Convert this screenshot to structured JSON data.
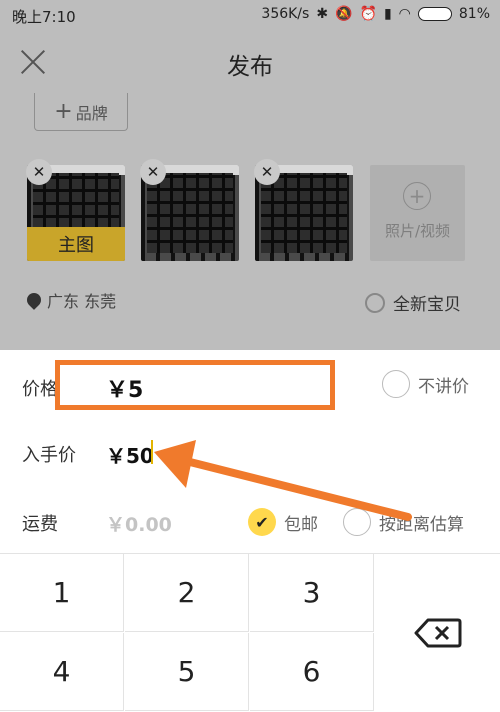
{
  "status_bar": {
    "time": "晚上7:10",
    "speed": "356K/s",
    "battery": "81%"
  },
  "header": {
    "title": "发布"
  },
  "brand_button": {
    "label": "品牌"
  },
  "photos": {
    "main_label": "主图",
    "add_media_label": "照片/视频"
  },
  "location": {
    "text": "广东 东莞"
  },
  "brand_new": {
    "label": "全新宝贝"
  },
  "price": {
    "label": "价格",
    "value": "￥5",
    "negotiable_label": "不讲价"
  },
  "buy_price": {
    "label": "入手价",
    "value": "￥50"
  },
  "shipping": {
    "label": "运费",
    "placeholder": "￥0.00",
    "free_label": "包邮",
    "distance_label": "按距离估算"
  },
  "keypad": {
    "keys": [
      "1",
      "2",
      "3",
      "4",
      "5",
      "6"
    ]
  },
  "colors": {
    "highlight": "#f07a2c",
    "accent": "#ffd84d"
  }
}
